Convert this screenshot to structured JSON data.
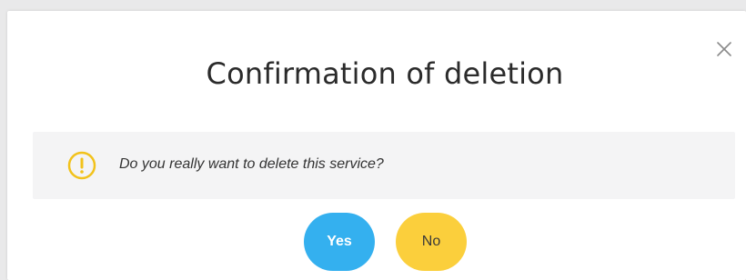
{
  "dialog": {
    "title": "Confirmation of deletion",
    "message": "Do you really want to delete this service?",
    "close_icon": "close-icon",
    "warning_icon": "warning-circle-icon",
    "buttons": {
      "yes_label": "Yes",
      "no_label": "No"
    }
  },
  "colors": {
    "yes_button": "#34b0ef",
    "no_button": "#fbcf3c",
    "warning_icon": "#f2c21b",
    "message_background": "#f4f4f5"
  }
}
